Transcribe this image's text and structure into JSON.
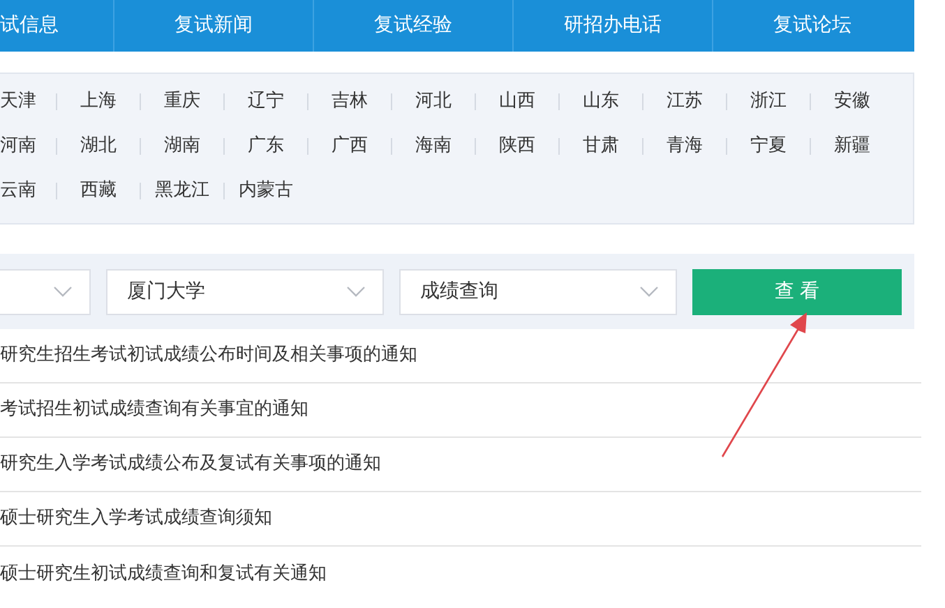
{
  "nav": {
    "tabs": [
      {
        "label": "试信息"
      },
      {
        "label": "复试新闻"
      },
      {
        "label": "复试经验"
      },
      {
        "label": "研招办电话"
      },
      {
        "label": "复试论坛"
      }
    ]
  },
  "provinces": [
    [
      "天津",
      "上海",
      "重庆",
      "辽宁",
      "吉林",
      "河北",
      "山西",
      "山东",
      "江苏",
      "浙江",
      "安徽"
    ],
    [
      "河南",
      "湖北",
      "湖南",
      "广东",
      "广西",
      "海南",
      "陕西",
      "甘肃",
      "青海",
      "宁夏",
      "新疆"
    ],
    [
      "云南",
      "西藏",
      "黑龙江",
      "内蒙古"
    ]
  ],
  "filters": {
    "selects": [
      {
        "kind": "dropdown"
      },
      {
        "kind": "dropdown",
        "value": "厦门大学"
      },
      {
        "kind": "dropdown",
        "value": "成绩查询"
      }
    ],
    "button": "查 看"
  },
  "notices": [
    "研究生招生考试初试成绩公布时间及相关事项的通知",
    "考试招生初试成绩查询有关事宜的通知",
    "研究生入学考试成绩公布及复试有关事项的通知",
    "硕士研究生入学考试成绩查询须知",
    "硕士研究生初试成绩查询和复试有关通知"
  ]
}
